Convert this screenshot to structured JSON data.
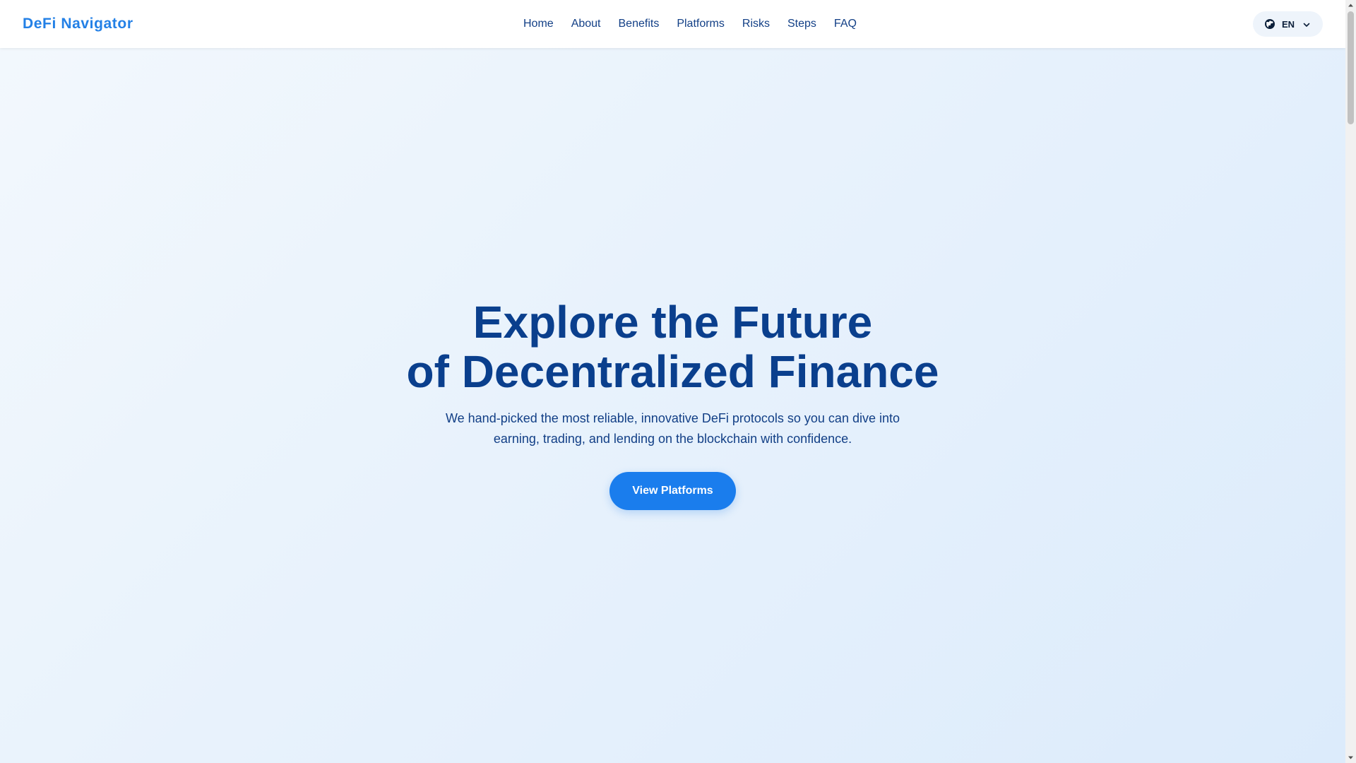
{
  "brand": {
    "name": "DeFi Navigator",
    "color": "#2380e6"
  },
  "nav": {
    "items": [
      {
        "label": "Home"
      },
      {
        "label": "About"
      },
      {
        "label": "Benefits"
      },
      {
        "label": "Platforms"
      },
      {
        "label": "Risks"
      },
      {
        "label": "Steps"
      },
      {
        "label": "FAQ"
      }
    ]
  },
  "language": {
    "selected": "EN",
    "icon": "globe-icon",
    "dropdown_icon": "chevron-down-icon"
  },
  "hero": {
    "title_line1": "Explore the Future",
    "title_line2": "of Decentralized Finance",
    "subtitle": "We hand-picked the most reliable, innovative DeFi protocols so you can dive into earning, trading, and lending on the blockchain with confidence.",
    "cta_label": "View Platforms"
  },
  "colors": {
    "accent": "#1a7ded",
    "heading": "#0a3f8d",
    "nav_text": "#123f86",
    "background_start": "#f3f8fd",
    "background_end": "#dcebfb"
  }
}
